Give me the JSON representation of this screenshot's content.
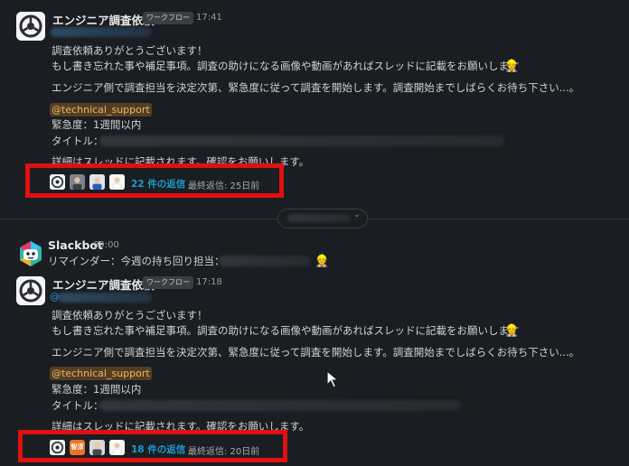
{
  "messages": [
    {
      "sender": "エンジニア調査依頼",
      "badge": "ワークフロー",
      "time": "17:41",
      "greeting": "調査依頼ありがとうございます！",
      "line2": "もし書き忘れた事や補足事項。調査の助けになる画像や動画があればスレッドに記載をお願いします",
      "line3": "エンジニア側で調査担当を決定次第、緊急度に従って調査を開始します。調査開始までしばらくお待ち下さい...。",
      "mention": "@technical_support",
      "urgency": "緊急度：1週間以内",
      "title_label": "タイトル：",
      "detail_partial": "詳細はスレッドに記載されます。確認をお願いします。",
      "replies": {
        "count_label": "22 件の返信",
        "last_reply": "最終返信: 25日前"
      }
    },
    {
      "sender": "Slackbot",
      "time": "09:00",
      "text": "リマインダー：今週の持ち回り担当："
    },
    {
      "sender": "エンジニア調査依頼",
      "badge": "ワークフロー",
      "time": "17:18",
      "mention_partial": "@",
      "greeting": "調査依頼ありがとうございます！",
      "line2": "もし書き忘れた事や補足事項。調査の助けになる画像や動画があればスレッドに記載をお願いします",
      "line3": "エンジニア側で調査担当を決定次第、緊急度に従って調査を開始します。調査開始までしばらくお待ち下さい...。",
      "mention": "@technical_support",
      "urgency": "緊急度：1週間以内",
      "title_label": "タイトル：",
      "detail_partial": "詳細はスレッドに記載されます。確認をお願いします。",
      "replies": {
        "count_label": "18 件の返信",
        "last_reply": "最終返信: 20日前",
        "orange_avatar_text": "智淳"
      }
    }
  ],
  "date_divider": {
    "chevron": "⌄"
  },
  "icons": [
    "workflow-avatar-icon",
    "slackbot-avatar-icon",
    "helmet-emoji-icon",
    "person-emoji-icon",
    "cursor-icon"
  ],
  "colors": {
    "background": "#1a1d21",
    "link": "#1d9bd1",
    "highlight_box": "#e01010",
    "mention": "#e8b866"
  }
}
